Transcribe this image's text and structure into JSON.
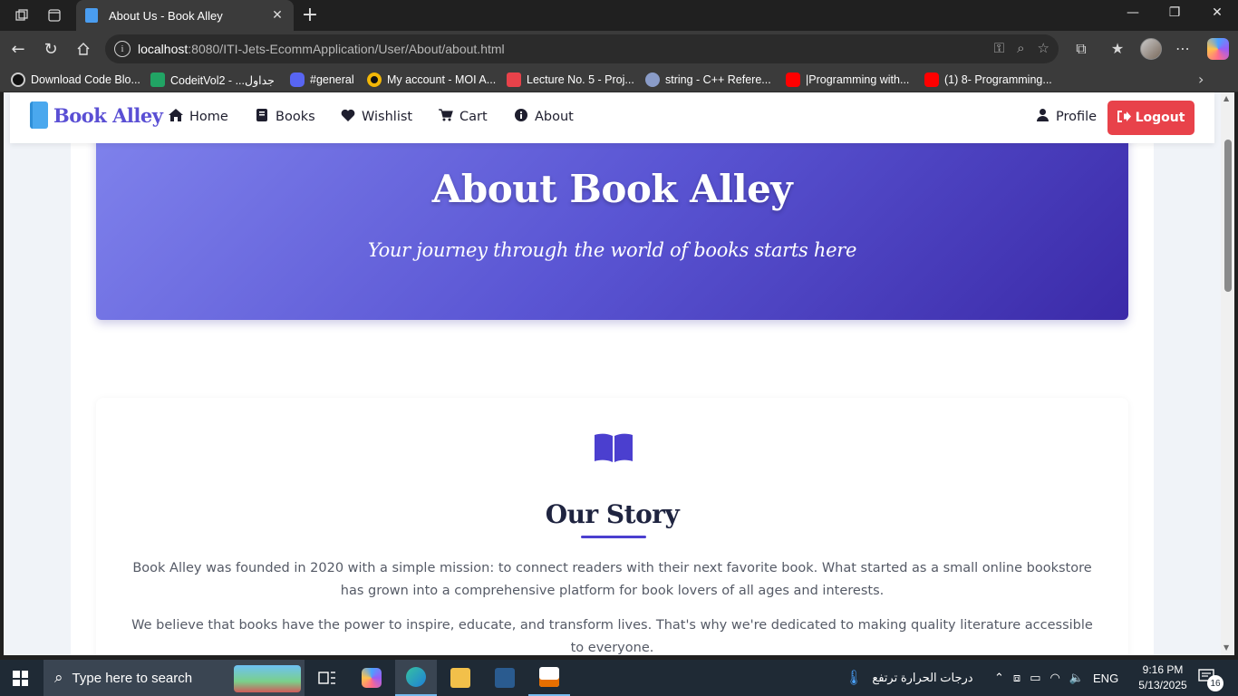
{
  "browser": {
    "tab_title": "About Us - Book Alley",
    "url_host": "localhost",
    "url_path": ":8080/ITI-Jets-EcommApplication/User/About/about.html",
    "bookmarks": [
      {
        "label": "Download Code Blo...",
        "icon_color": "#111111"
      },
      {
        "label": "CodeitVol2 - ...جداول",
        "icon_color": "#21a464"
      },
      {
        "label": "#general",
        "icon_color": "#5865f2"
      },
      {
        "label": "My account - MOI A...",
        "icon_color": "#f2b707"
      },
      {
        "label": "Lecture No. 5 - Proj...",
        "icon_color": "#e8424a"
      },
      {
        "label": "string - C++ Refere...",
        "icon_color": "#8a9cc8"
      },
      {
        "label": "|Programming with...",
        "icon_color": "#ff0000"
      },
      {
        "label": "(1) 8- Programming...",
        "icon_color": "#ff0000"
      }
    ]
  },
  "navbar": {
    "brand": "Book Alley",
    "items": [
      {
        "label": "Home",
        "icon": "home-icon"
      },
      {
        "label": "Books",
        "icon": "book-icon"
      },
      {
        "label": "Wishlist",
        "icon": "heart-icon"
      },
      {
        "label": "Cart",
        "icon": "cart-icon"
      },
      {
        "label": "About",
        "icon": "info-icon"
      }
    ],
    "profile": "Profile",
    "logout": "Logout"
  },
  "hero": {
    "title": "About Book Alley",
    "subtitle": "Your journey through the world of books starts here"
  },
  "story": {
    "title": "Our Story",
    "paragraphs": [
      "Book Alley was founded in 2020 with a simple mission: to connect readers with their next favorite book. What started as a small online bookstore has grown into a comprehensive platform for book lovers of all ages and interests.",
      "We believe that books have the power to inspire, educate, and transform lives. That's why we're dedicated to making quality literature accessible to everyone."
    ]
  },
  "taskbar": {
    "search_placeholder": "Type here to search",
    "weather": "درجات الحرارة ترتفع",
    "language": "ENG",
    "time": "9:16 PM",
    "date": "5/13/2025",
    "notifications": "16"
  },
  "colors": {
    "accent": "#4b3fcf",
    "logout": "#e8424a",
    "hero_start": "#7f82ec",
    "hero_end": "#3b2aa8"
  }
}
